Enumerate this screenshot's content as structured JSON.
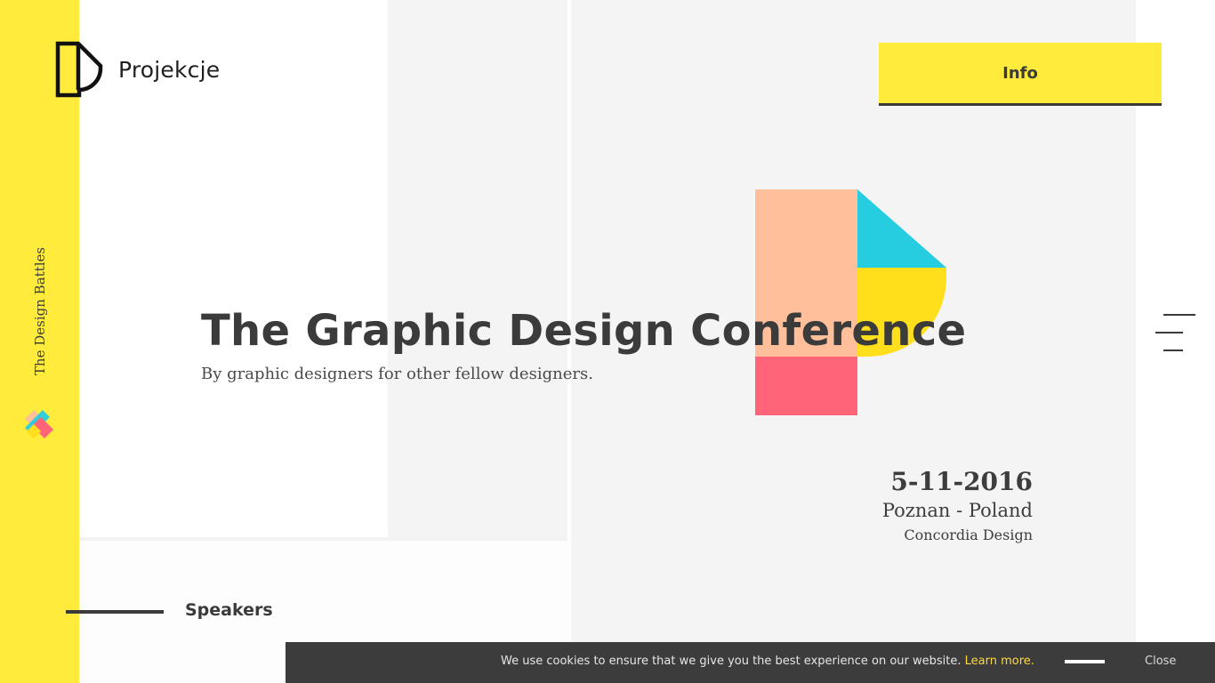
{
  "brand": {
    "name": "Projekcje",
    "tagline": "The Design Battles"
  },
  "header": {
    "info_label": "Info"
  },
  "hero": {
    "title": "The Graphic Design Conference",
    "subtitle": "By graphic designers for other fellow designers."
  },
  "event": {
    "date": "5-11-2016",
    "location": "Poznan - Poland",
    "venue": "Concordia Design"
  },
  "sections": {
    "speakers_label": "Speakers"
  },
  "cookie": {
    "message": "We use cookies to ensure that we give you the best experience on our website.",
    "learn_more": "Learn more.",
    "close_label": "Close"
  },
  "colors": {
    "accent_yellow": "#ffeb3b",
    "dark": "#3c3c3c",
    "peach": "#ffbf9b",
    "cyan": "#26cde0",
    "gold": "#ffdf1b",
    "pink": "#ff6479"
  },
  "icons": {
    "menu": "hamburger-menu-icon",
    "logo": "projekcje-logo-icon",
    "rail_mark": "x-mark-icon"
  }
}
